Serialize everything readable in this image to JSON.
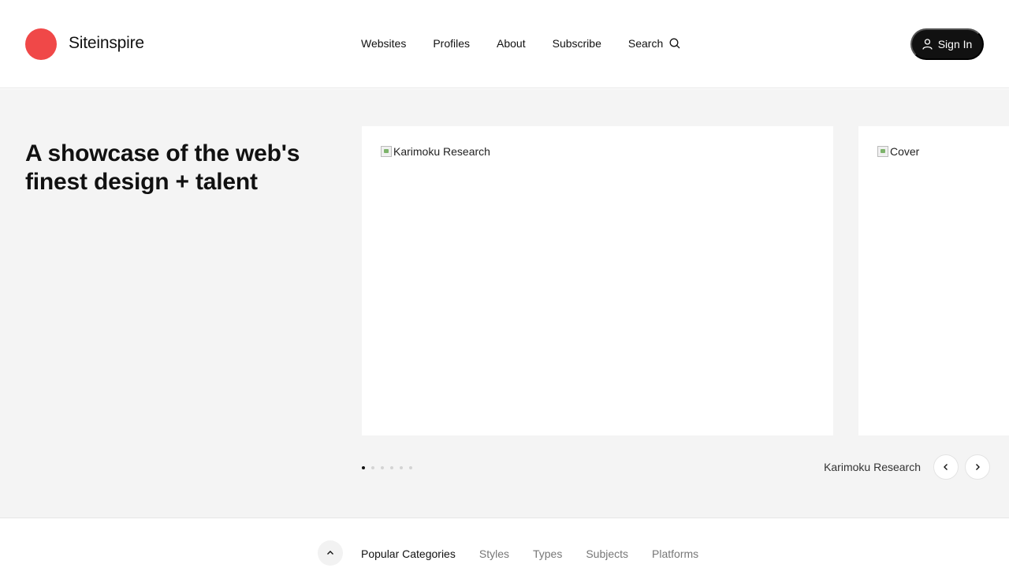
{
  "brand": {
    "name": "Siteinspire",
    "logo_color": "#f04848"
  },
  "nav": {
    "items": [
      "Websites",
      "Profiles",
      "About",
      "Subscribe"
    ],
    "search_label": "Search",
    "search_icon": "search-icon"
  },
  "signin": {
    "label": "Sign In",
    "icon": "user-icon",
    "bg": "#111111"
  },
  "hero": {
    "tagline": "A showcase of the web's finest design + talent",
    "slides": [
      {
        "alt": "Karimoku Research"
      },
      {
        "alt": "Cover"
      }
    ],
    "dots_count": 6,
    "active_dot": 1,
    "caption": "Karimoku Research"
  },
  "categories": {
    "items": [
      "Popular Categories",
      "Styles",
      "Types",
      "Subjects",
      "Platforms"
    ],
    "active": "Popular Categories"
  }
}
